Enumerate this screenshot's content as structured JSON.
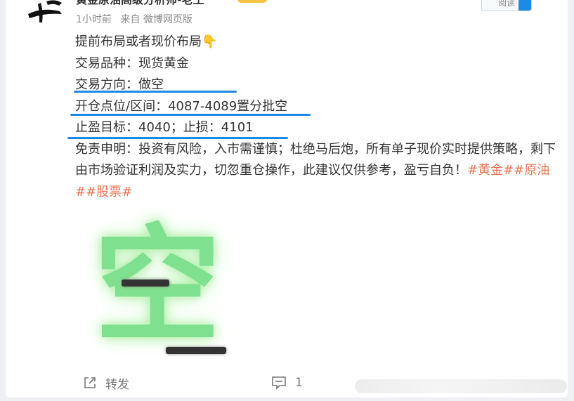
{
  "post": {
    "author_name": "黄金原油高级分析师-老王",
    "time": "1小时前",
    "source": "来自 微博网页版",
    "follow_label": "阅读",
    "lines": {
      "l1": "提前布局或者现价布局👇",
      "l2": "交易品种：现货黄金",
      "l3": "交易方向：做空",
      "l4": "开仓点位/区间：4087-4089置分批空",
      "l5": "止盈目标：4040；止损：4101",
      "disclaimer": "免责申明：投资有风险，入市需谨慎；杜绝马后炮，所有单子现价实时提供策略，剩下由市场验证利润及实力，切忽重仓操作，此建议仅供参考，盈亏自负！",
      "tag1": "#黄金#",
      "tag2": "#原油#",
      "tag3": "#股票#"
    },
    "image_char": "空",
    "actions": {
      "repost_label": "转发",
      "comment_count": "1"
    }
  },
  "colors": {
    "accent_blue": "#1e88e5",
    "tag_orange": "#eb7350",
    "glow_green": "#7fe08f"
  }
}
